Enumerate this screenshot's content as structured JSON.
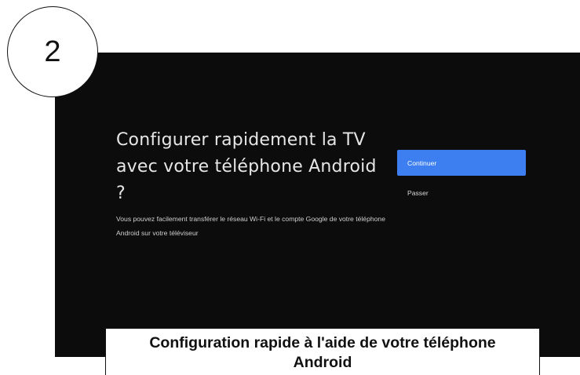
{
  "step": {
    "number": "2"
  },
  "screen": {
    "title": "Configurer rapidement la TV avec votre téléphone Android ?",
    "description": "Vous pouvez facilement transférer le réseau Wi-Fi et le compte Google de votre téléphone Android sur votre téléviseur",
    "continue_label": "Continuer",
    "skip_label": "Passer"
  },
  "caption": {
    "text": "Configuration rapide à l'aide de votre téléphone Android"
  },
  "colors": {
    "screen_background": "#0c0c0c",
    "accent_button": "#3d7ff0",
    "caption_background": "#ffffff"
  }
}
